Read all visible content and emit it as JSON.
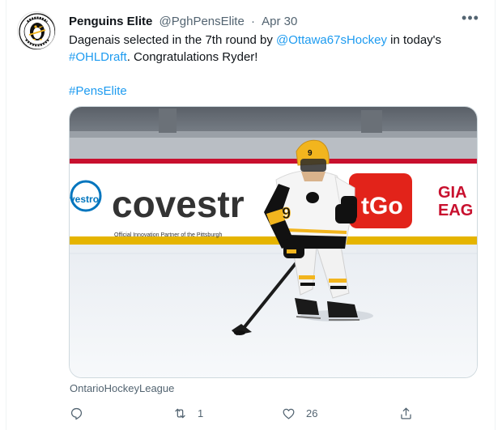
{
  "tweet": {
    "author_name": "Penguins Elite",
    "author_handle": "@PghPensElite",
    "separator": "·",
    "date": "Apr 30",
    "more_label": "•••",
    "text_line1_before": "Dagenais selected in the 7th round by ",
    "mention": "@Ottawa67sHockey",
    "text_line1_after": " in today's",
    "hashtag1": "#OHLDraft",
    "text_line2_after": ". Congratulations Ryder!",
    "hashtag2": "#PensElite",
    "media_source": "OntarioHockeyLeague",
    "image_alt": "Penguins Elite player #9 skating with the puck in front of a Covestro rink board"
  },
  "rink_boards": {
    "ad1": "covestr",
    "ad1_tagline": "Official Innovation Partner of the Pittsburgh",
    "ad_left_fragment": "vestro",
    "ad2": "tGo",
    "ad3_line1": "GIA",
    "ad3_line2": "EAG"
  },
  "player": {
    "jersey_number": "9"
  },
  "actions": {
    "reply_count": "",
    "retweet_count": "1",
    "like_count": "26",
    "share_count": ""
  },
  "colors": {
    "link": "#1d9bf0",
    "secondary_text": "#536471",
    "primary_text": "#0f1419",
    "jersey_gold": "#f2b51e",
    "rink_red": "#c8102e"
  },
  "icons": [
    "penguins-elite-logo",
    "more-icon",
    "reply-icon",
    "retweet-icon",
    "like-icon",
    "share-icon"
  ]
}
